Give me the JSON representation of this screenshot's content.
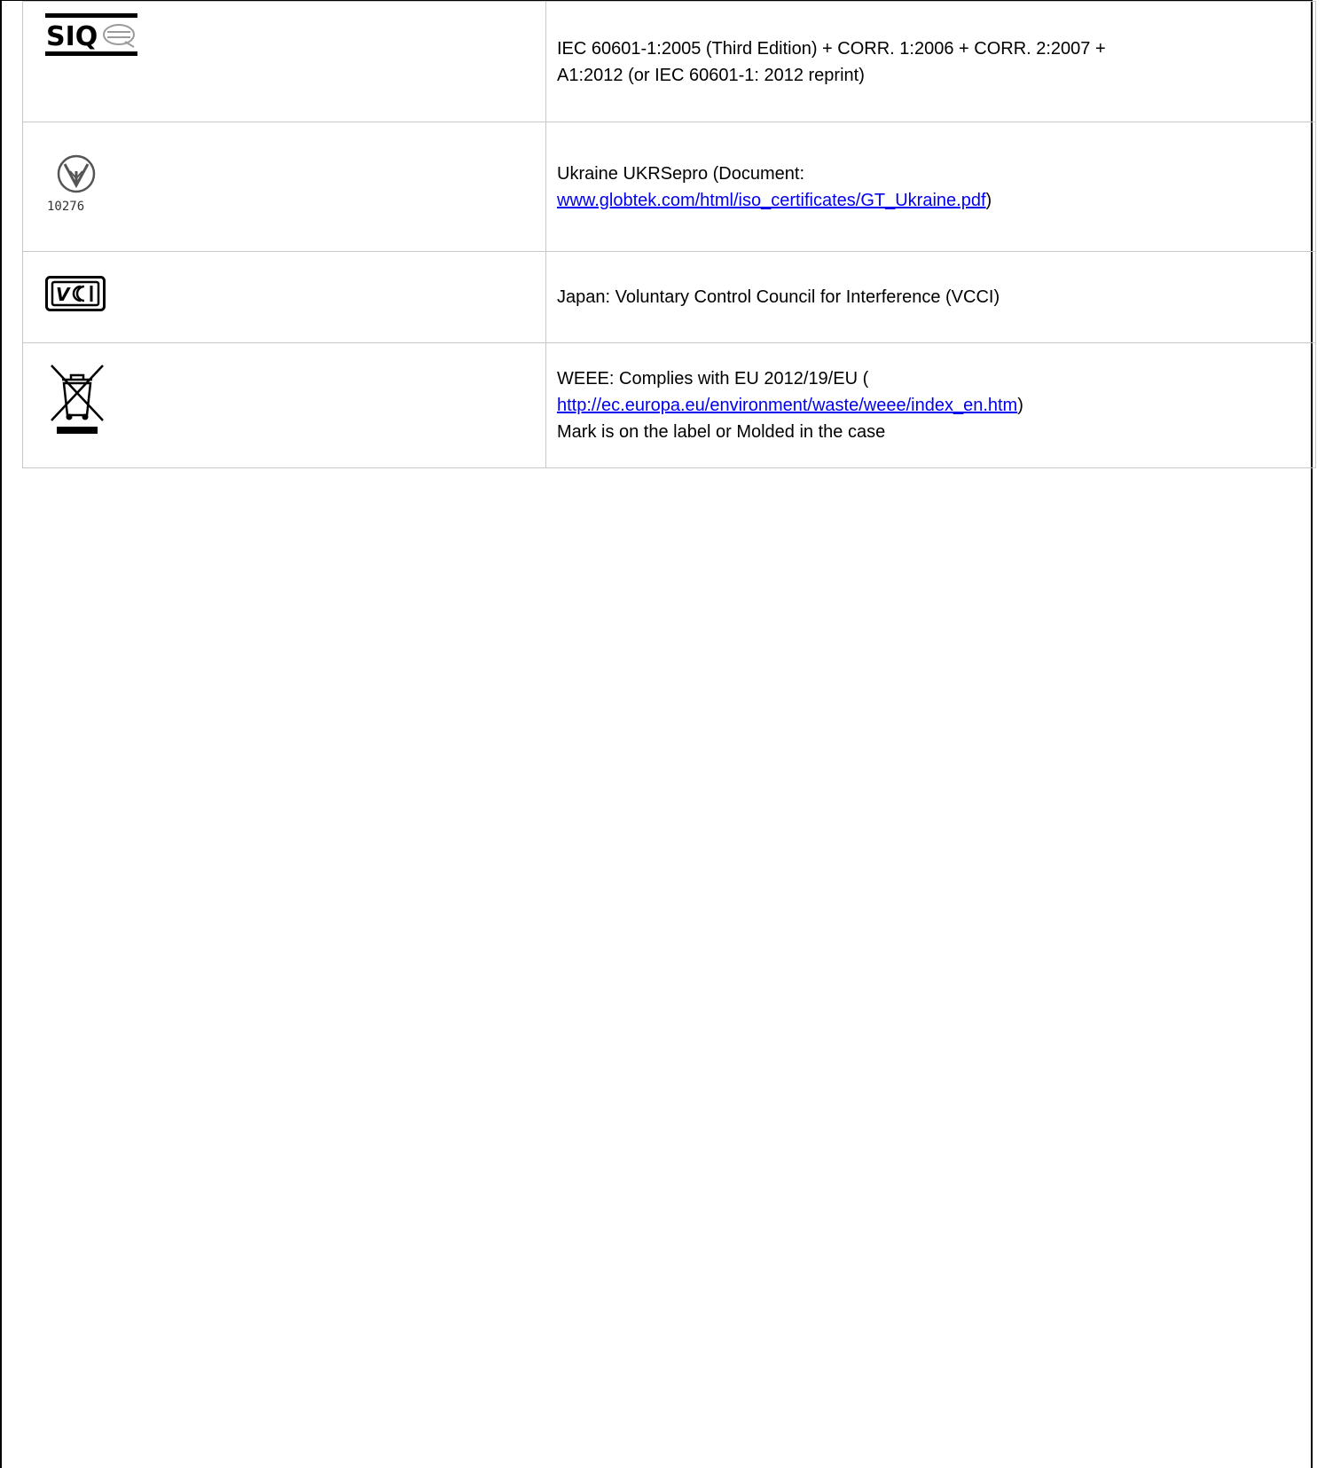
{
  "rows": [
    {
      "mark": "SIQ",
      "text_lines": [
        "IEC 60601-1:2005 (Third Edition) + CORR. 1:2006 + CORR. 2:2007 +",
        "A1:2012 (or IEC 60601-1: 2012 reprint)"
      ]
    },
    {
      "mark": "UkrSEPRO",
      "mark_number": "10276",
      "text_before": "Ukraine UKRSepro (Document:",
      "link": "www.globtek.com/html/iso_certificates/GT_Ukraine.pdf",
      "text_after": ")"
    },
    {
      "mark": "VCCI",
      "text": "Japan: Voluntary Control Council for Interference (VCCI)"
    },
    {
      "mark": "WEEE",
      "text_before": "WEEE: Complies with EU 2012/19/EU (",
      "link": "http://ec.europa.eu/environment/waste/weee/index_en.htm",
      "text_after": ")",
      "note": "Mark is on the label or Molded in the case"
    }
  ],
  "icons": {
    "siq": "siq-logo-icon",
    "ukr": "ukrsepro-mark-icon",
    "vcci": "vcci-logo-icon",
    "weee": "weee-crossed-bin-icon"
  }
}
